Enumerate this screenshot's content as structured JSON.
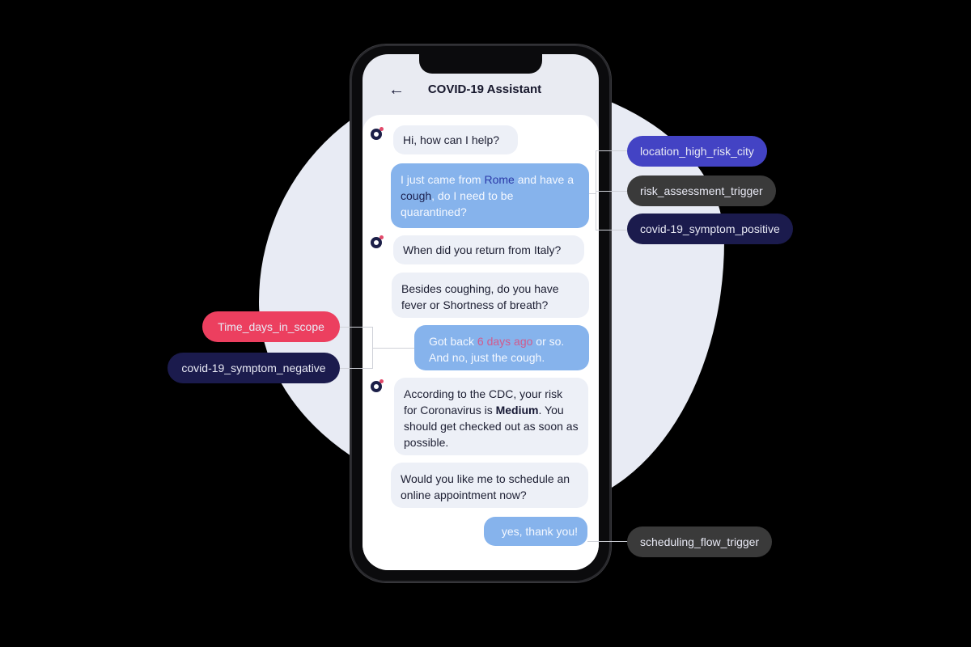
{
  "app": {
    "title": "COVID-19 Assistant",
    "back_icon": "arrow-left-icon"
  },
  "colors": {
    "bot_bubble": "#edf0f7",
    "user_bubble": "#86b3ec",
    "tag_location": "#4343c4",
    "tag_trigger": "#3a3a3a",
    "tag_symptom": "#1b1b4d",
    "tag_time": "#ec3f5f"
  },
  "messages": [
    {
      "sender": "bot",
      "text": "Hi, how can I help?"
    },
    {
      "sender": "user",
      "parts": [
        "I just came from ",
        "Rome",
        " and have a ",
        "cough",
        ", do I need to be quarantined?"
      ]
    },
    {
      "sender": "bot",
      "text": "When did you return from Italy?"
    },
    {
      "sender": "bot",
      "text": "Besides coughing, do you have fever or Shortness of breath?"
    },
    {
      "sender": "user",
      "parts": [
        "Got back ",
        "6 days ago",
        " or so. And no, just the cough."
      ]
    },
    {
      "sender": "bot",
      "parts": [
        "According to the CDC, your risk for Coronavirus is ",
        "Medium",
        ". You should get checked out as soon as possible."
      ]
    },
    {
      "sender": "bot",
      "text": "Would you like me to schedule an online appointment now?"
    },
    {
      "sender": "user",
      "text": "yes, thank you!"
    }
  ],
  "tags": {
    "location": "location_high_risk_city",
    "risk_trigger": "risk_assessment_trigger",
    "symptom_positive": "covid-19_symptom_positive",
    "time": "Time_days_in_scope",
    "symptom_negative": "covid-19_symptom_negative",
    "scheduling": "scheduling_flow_trigger"
  }
}
